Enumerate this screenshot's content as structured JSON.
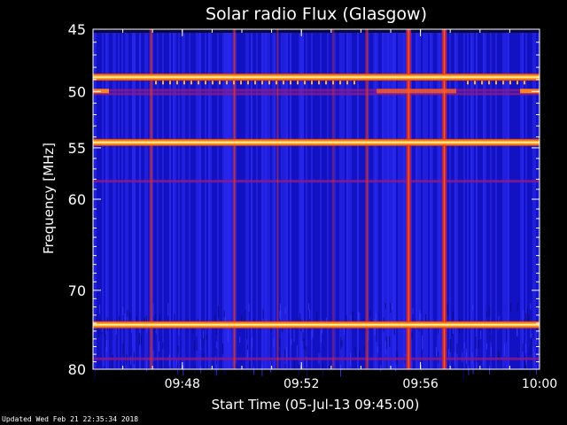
{
  "chart_data": {
    "type": "heatmap",
    "title": "Solar radio Flux (Glasgow)",
    "xlabel": "Start Time (05-Jul-13 09:45:00)",
    "ylabel": "Frequency [MHz]",
    "xlim": [
      "09:45",
      "10:00"
    ],
    "ylim": [
      45,
      80
    ],
    "y_scale": "log",
    "x_ticks": [
      "09:48",
      "09:52",
      "09:56",
      "10:00"
    ],
    "y_ticks": [
      45,
      50,
      55,
      60,
      70,
      80
    ],
    "grid": false,
    "colormap": "black-blue-red-yellow-white",
    "bright_horizontal_bands_mhz": [
      48.8,
      54.5,
      74.2
    ],
    "medium_horizontal_bands_mhz": [
      49.9,
      50.2,
      58.2,
      78.6
    ],
    "vertical_features": [
      {
        "time": "09:46:57",
        "intensity": "medium"
      },
      {
        "time": "09:49:45",
        "intensity": "medium"
      },
      {
        "time": "09:51:12",
        "intensity": "low"
      },
      {
        "time": "09:53:04",
        "intensity": "low"
      },
      {
        "time": "09:54:12",
        "intensity": "medium"
      },
      {
        "time": "09:55:36",
        "intensity": "high"
      },
      {
        "time": "09:56:48",
        "intensity": "high"
      }
    ]
  },
  "footer": "Updated Wed Feb 21 22:35:34 2018",
  "colors": {
    "background": "#000000",
    "plot_base": "#1a1ad2",
    "band_core": "#ffffc0",
    "band_edge": "#e03010",
    "spike": "#d02020"
  }
}
